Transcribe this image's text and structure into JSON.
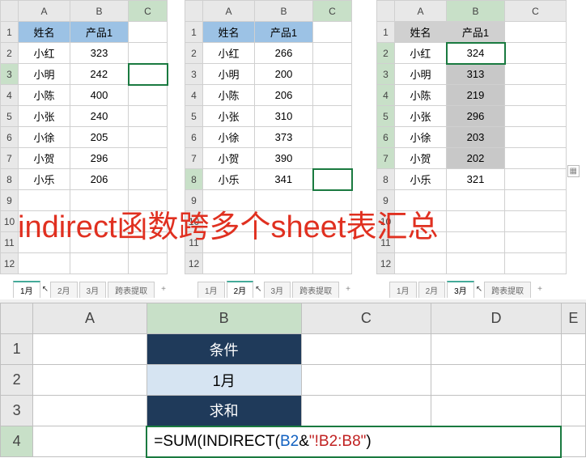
{
  "headers": {
    "name": "姓名",
    "product": "产品1"
  },
  "names": [
    "小红",
    "小明",
    "小陈",
    "小张",
    "小徐",
    "小贺",
    "小乐"
  ],
  "chart_data": [
    {
      "type": "table",
      "title": "1月",
      "categories": [
        "小红",
        "小明",
        "小陈",
        "小张",
        "小徐",
        "小贺",
        "小乐"
      ],
      "values": [
        323,
        242,
        400,
        240,
        205,
        296,
        206
      ]
    },
    {
      "type": "table",
      "title": "2月",
      "categories": [
        "小红",
        "小明",
        "小陈",
        "小张",
        "小徐",
        "小贺",
        "小乐"
      ],
      "values": [
        266,
        200,
        206,
        310,
        373,
        390,
        341
      ]
    },
    {
      "type": "table",
      "title": "3月",
      "categories": [
        "小红",
        "小明",
        "小陈",
        "小张",
        "小徐",
        "小贺",
        "小乐"
      ],
      "values": [
        324,
        313,
        219,
        296,
        203,
        202,
        321
      ]
    }
  ],
  "tabs": {
    "t1": "1月",
    "t2": "2月",
    "t3": "3月",
    "t4": "跨表提取",
    "plus": "+"
  },
  "overlay_text": "indirect函数跨多个sheet表汇总",
  "bottom": {
    "b1": "条件",
    "b2": "1月",
    "b3": "求和",
    "formula_prefix": "=SUM(",
    "formula_fn": "INDIRECT(",
    "formula_ref": "B2",
    "formula_amp": "&",
    "formula_str": "\"!B2:B8\"",
    "formula_close": ")"
  },
  "cols": {
    "A": "A",
    "B": "B",
    "C": "C",
    "D": "D",
    "E": "E"
  },
  "rows": {
    "r1": "1",
    "r2": "2",
    "r3": "3",
    "r4": "4",
    "r5": "5",
    "r6": "6",
    "r7": "7",
    "r8": "8",
    "r9": "9",
    "r10": "10",
    "r11": "11",
    "r12": "12"
  }
}
